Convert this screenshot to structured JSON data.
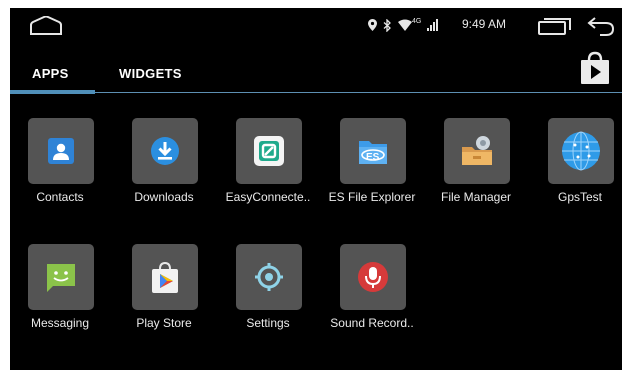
{
  "statusbar": {
    "clock": "9:49 AM",
    "network": "4G",
    "icons": [
      "home-icon",
      "location-icon",
      "bluetooth-icon",
      "wifi-icon",
      "signal-icon",
      "recents-icon",
      "back-icon"
    ]
  },
  "tabs": [
    {
      "label": "APPS",
      "selected": true
    },
    {
      "label": "WIDGETS",
      "selected": false
    }
  ],
  "accent_color": "#4f8fb9",
  "apps": [
    {
      "label": "Contacts",
      "icon": "contacts-icon"
    },
    {
      "label": "Downloads",
      "icon": "downloads-icon"
    },
    {
      "label": "EasyConnecte..",
      "icon": "easyconnection-icon"
    },
    {
      "label": "ES File Explorer",
      "icon": "es-file-explorer-icon"
    },
    {
      "label": "File Manager",
      "icon": "file-manager-icon"
    },
    {
      "label": "GpsTest",
      "icon": "gps-globe-icon"
    },
    {
      "label": "Messaging",
      "icon": "messaging-icon"
    },
    {
      "label": "Play Store",
      "icon": "play-store-icon"
    },
    {
      "label": "Settings",
      "icon": "settings-icon"
    },
    {
      "label": "Sound Record..",
      "icon": "microphone-icon"
    }
  ]
}
